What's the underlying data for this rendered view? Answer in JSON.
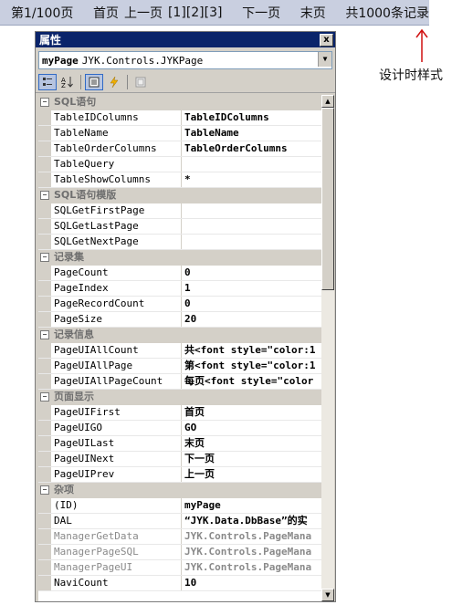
{
  "pager": {
    "page_info": "第1/100页",
    "first": "首页",
    "prev": "上一页",
    "pages": [
      "[1]",
      "[2]",
      "[3]"
    ],
    "next": "下一页",
    "last": "末页",
    "total": "共1000条记录"
  },
  "annotation": "设计时样式",
  "window": {
    "title": "属性",
    "close": "x",
    "object_name": "myPage",
    "object_type": "JYK.Controls.JYKPage"
  },
  "toolbar": {
    "icons": [
      "categorized-icon",
      "alphabetical-icon",
      "properties-icon",
      "events-icon",
      "property-pages-icon"
    ]
  },
  "grid": [
    {
      "category": "SQL语句",
      "rows": [
        {
          "name": "TableIDColumns",
          "value": "TableIDColumns"
        },
        {
          "name": "TableName",
          "value": "TableName"
        },
        {
          "name": "TableOrderColumns",
          "value": "TableOrderColumns"
        },
        {
          "name": "TableQuery",
          "value": ""
        },
        {
          "name": "TableShowColumns",
          "value": "*"
        }
      ]
    },
    {
      "category": "SQL语句模版",
      "rows": [
        {
          "name": "SQLGetFirstPage",
          "value": ""
        },
        {
          "name": "SQLGetLastPage",
          "value": ""
        },
        {
          "name": "SQLGetNextPage",
          "value": ""
        }
      ]
    },
    {
      "category": "记录集",
      "rows": [
        {
          "name": "PageCount",
          "value": "0"
        },
        {
          "name": "PageIndex",
          "value": "1"
        },
        {
          "name": "PageRecordCount",
          "value": "0"
        },
        {
          "name": "PageSize",
          "value": "20"
        }
      ]
    },
    {
      "category": "记录信息",
      "rows": [
        {
          "name": "PageUIAllCount",
          "value": "共<font style=\"color:1"
        },
        {
          "name": "PageUIAllPage",
          "value": "第<font style=\"color:1"
        },
        {
          "name": "PageUIAllPageCount",
          "value": "每页<font style=\"color"
        }
      ]
    },
    {
      "category": "页面显示",
      "rows": [
        {
          "name": "PageUIFirst",
          "value": "首页"
        },
        {
          "name": "PageUIGO",
          "value": "GO"
        },
        {
          "name": "PageUILast",
          "value": "末页"
        },
        {
          "name": "PageUINext",
          "value": "下一页"
        },
        {
          "name": "PageUIPrev",
          "value": "上一页"
        }
      ]
    },
    {
      "category": "杂项",
      "rows": [
        {
          "name": "(ID)",
          "value": "myPage"
        },
        {
          "name": "DAL",
          "value": "“JYK.Data.DbBase”的实"
        },
        {
          "name": "ManagerGetData",
          "value": "JYK.Controls.PageMana",
          "dim": true
        },
        {
          "name": "ManagerPageSQL",
          "value": "JYK.Controls.PageMana",
          "dim": true
        },
        {
          "name": "ManagerPageUI",
          "value": "JYK.Controls.PageMana",
          "dim": true
        },
        {
          "name": "NaviCount",
          "value": "10"
        }
      ]
    }
  ]
}
